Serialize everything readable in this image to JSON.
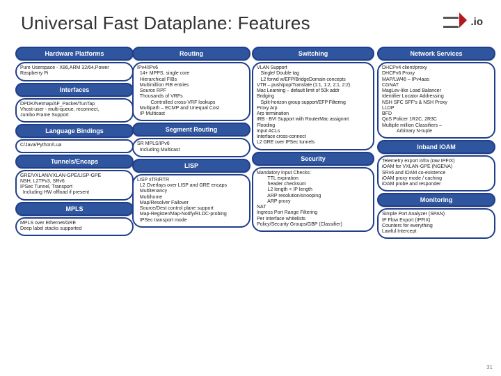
{
  "header": {
    "title": "Universal Fast Dataplane: Features",
    "logo_suffix": ".io"
  },
  "col1": {
    "p1": "Hardware Platforms",
    "b1": [
      "Pure Userspace - X86,ARM 32/64,Power",
      "Raspberry Pi"
    ],
    "p2": "Interfaces",
    "b2": [
      "DPDK/Netmap/AF_Packet/TunTap",
      "Vhost-user - multi-queue, reconnect,",
      "Jumbo Frame Support"
    ],
    "p3": "Language Bindings",
    "b3": [
      "C/Java/Python/Lua"
    ],
    "p4": "Tunnels/Encaps",
    "b4": [
      "GRE/VXLAN/VXLAN-GPE/LISP-GPE",
      "NSH, L2TPv3, SRv6",
      "IPSec Tunnel, Transport",
      "  Including HW offload if present"
    ],
    "p5": "MPLS",
    "b5": [
      "MPLS over Ethernet/GRE",
      "Deep label stacks supported"
    ]
  },
  "col2": {
    "p1": "Routing",
    "b1": [
      "IPv4/IPv6",
      "  14+ MPPS, single core",
      "  Hierarchical FIBs",
      "  Multimillion FIB entries",
      "  Source RPF",
      "  Thousands of VRFs",
      "          Controlled cross-VRF lookups",
      "  Multipath – ECMP and Unequal Cost",
      "  IP Multicast"
    ],
    "p2": "Segment Routing",
    "b2": [
      "SR MPLS/IPv6",
      "  Including Multicast"
    ],
    "p3": "LISP",
    "b3": [
      "LISP xTR/RTR",
      "  L2 Overlays over LISP and GRE encaps",
      "  Multitenancy",
      "  Multihome",
      "  Map/Resolver Failover",
      "  Source/Dest control plane support",
      "  Map-Register/Map-Notify/RLOC-probing",
      "  IPSec transport mode"
    ]
  },
  "col3": {
    "p1": "Switching",
    "b1": [
      "VLAN Support",
      "   Single/ Double tag",
      "   L2 forwd w/EFP/BridgeDomain concepts",
      "VTR – push/pop/Translate (1:1, 1:2, 2:1, 2:2)",
      "Mac Learning – default limit of 50k addr",
      "Bridging",
      "   Split-horizon group support/EFP Filtering",
      "Proxy Arp",
      "Arp termination",
      "IRB - BVI Support with RouterMac assignmt",
      "Flooding",
      "Input ACLs",
      "Interface cross-connect",
      "L2 GRE over IPSec tunnels"
    ],
    "p2": "Security",
    "b2": [
      "Mandatory Input Checks:",
      "        TTL expiration",
      "        header checksum",
      "        L2 length < IP length",
      "        ARP resolution/snooping",
      "        ARP proxy",
      "NAT",
      "Ingress Port Range Filtering",
      "Per interface whitelists",
      "Policy/Security Groups/GBP (Classifier)"
    ]
  },
  "col4": {
    "p1": "Network Services",
    "b1": [
      "DHCPv4 client/proxy",
      "DHCPv6 Proxy",
      "MAP/LW46 – IPv4aas",
      "CGNAT",
      "MagLev-like Load Balancer",
      "Identifier Locator Addressing",
      "NSH SFC SFF's & NSH Proxy",
      "LLDP",
      "BFD",
      "QoS Policer 1R2C, 2R3C",
      "Multiple million Classifiers –",
      "           Arbitrary N-tuple"
    ],
    "p2": "Inband iOAM",
    "b2": [
      "Telemetry export infra (raw IPFIX)",
      "iOAM for VXLAN-GPE (NGENA)",
      "SRv6 and iOAM co-existence",
      "iOAM proxy mode / caching",
      "iOAM probe and responder"
    ],
    "p3": "Monitoring",
    "b3": [
      "Simple Port Analyzer (SPAN)",
      "IP Flow Export (IPFIX)",
      "Counters for everything",
      "Lawful Intercept"
    ]
  },
  "pagenum": "31"
}
